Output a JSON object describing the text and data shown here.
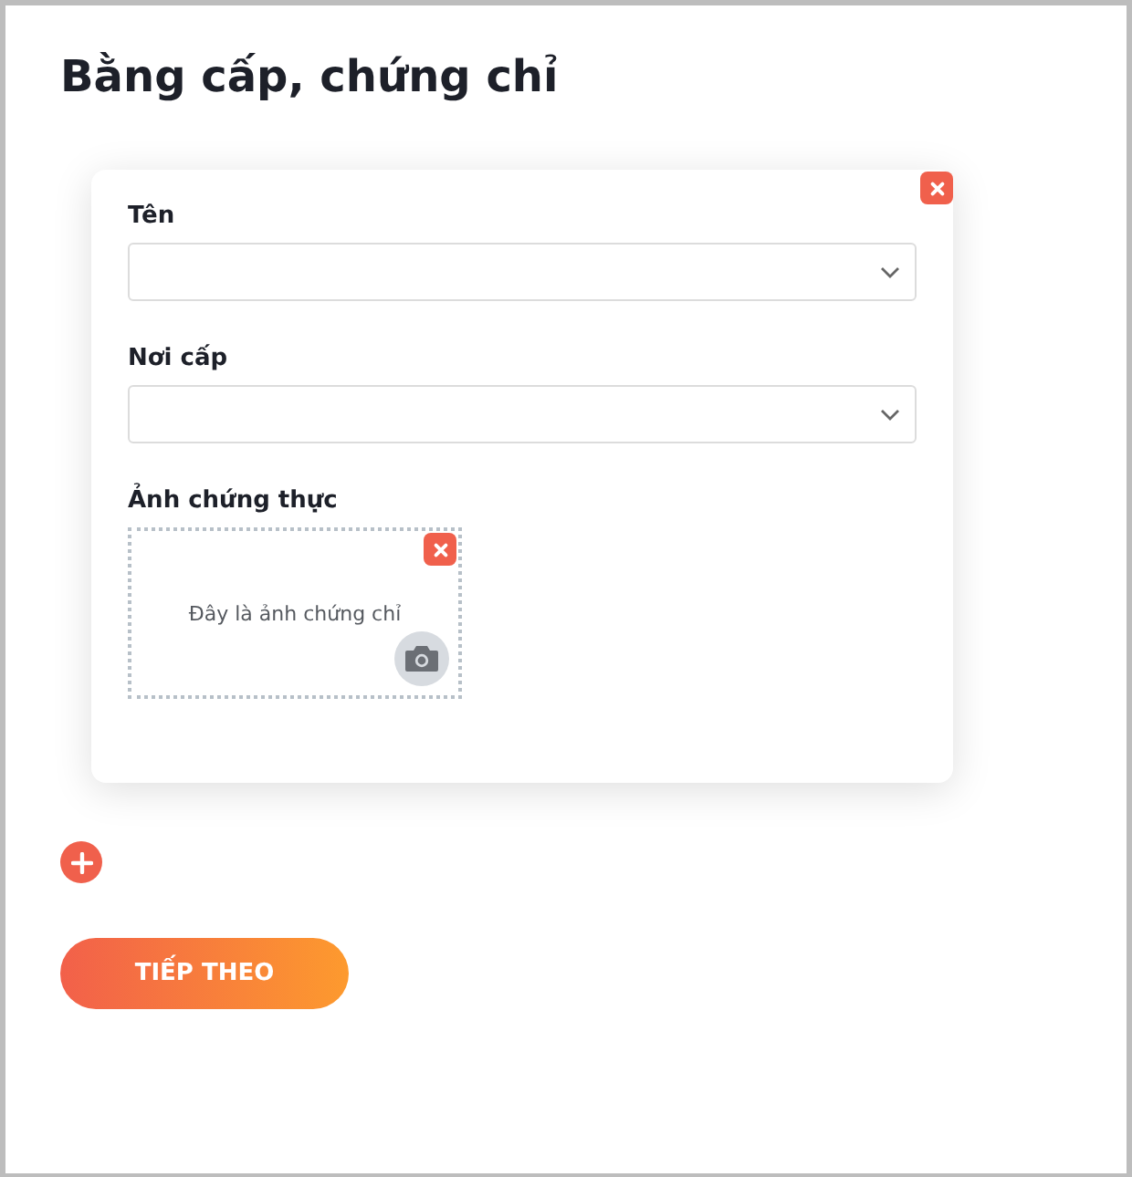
{
  "title": "Bằng cấp, chứng chỉ",
  "certificates": [
    {
      "fields": [
        {
          "kind": "select",
          "label": "Tên"
        },
        {
          "kind": "select",
          "label": "Nơi cấp"
        },
        {
          "kind": "photo",
          "label": "Ảnh chứng thực",
          "caption": "Đây là ảnh chứng chỉ"
        }
      ]
    }
  ],
  "next_button": "TIẾP THEO"
}
